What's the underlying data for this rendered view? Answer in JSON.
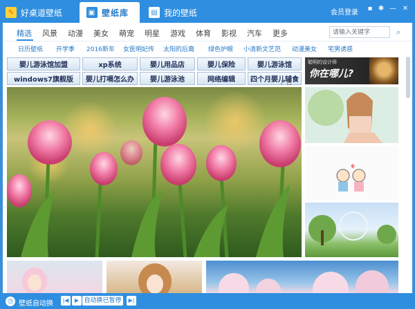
{
  "titlebar": {
    "tabs": [
      {
        "label": "好桌道壁纸",
        "icon": "app-logo-icon"
      },
      {
        "label": "壁纸库",
        "icon": "library-icon"
      },
      {
        "label": "我的壁纸",
        "icon": "my-wallpaper-icon"
      }
    ],
    "login": "会员登录",
    "buttons": [
      "chat-icon",
      "settings-icon",
      "minimize-icon",
      "close-icon"
    ]
  },
  "categories": [
    "精选",
    "风景",
    "动漫",
    "美女",
    "萌宠",
    "明星",
    "游戏",
    "体育",
    "影视",
    "汽车",
    "更多"
  ],
  "search": {
    "placeholder": "请输入关键字"
  },
  "tags": [
    "日历壁纸",
    "开学季",
    "2016新年",
    "女医明妃传",
    "太阳的后裔",
    "绿色护眼",
    "小清新文艺范",
    "动漫美女",
    "宅男诱惑"
  ],
  "ads": {
    "row1": [
      "婴儿游泳馆加盟",
      "xp系统",
      "婴儿用品店",
      "婴儿保险",
      "婴儿游泳馆"
    ],
    "row2": [
      "windows7旗舰版",
      "婴儿打嗝怎么办",
      "婴儿游泳池",
      "网络编辑",
      "四个月婴儿辅食"
    ],
    "banner_small": "聪明的设计师",
    "banner_big": "你在哪儿?",
    "close_label": "广告"
  },
  "bottom": {
    "auto_label": "壁纸自动换",
    "status": "自动换已暂停"
  },
  "colors": {
    "accent": "#2f8ee0",
    "link": "#2579c8"
  }
}
